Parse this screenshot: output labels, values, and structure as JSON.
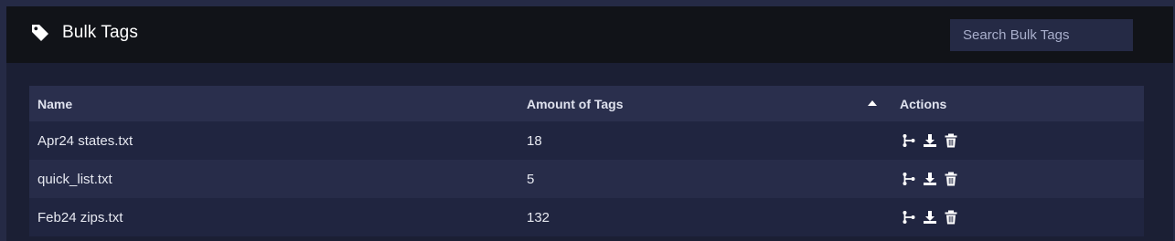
{
  "header": {
    "title": "Bulk Tags",
    "icon": "tag-icon",
    "search_placeholder": "Search Bulk Tags"
  },
  "table": {
    "columns": [
      "Name",
      "Amount of Tags",
      "Actions"
    ],
    "sort": {
      "column": "Amount of Tags",
      "direction": "ascending"
    },
    "rows": [
      {
        "name": "Apr24 states.txt",
        "amount": "18"
      },
      {
        "name": "quick_list.txt",
        "amount": "5"
      },
      {
        "name": "Feb24 zips.txt",
        "amount": "132"
      }
    ],
    "row_actions": [
      "branch-icon",
      "download-icon",
      "trash-icon"
    ]
  },
  "colors": {
    "page_bg": "#252a45",
    "panel_bg": "#1b1f34",
    "header_bg": "#111318",
    "table_header_bg": "#2a2f4d",
    "row_odd": "#202540",
    "row_even": "#272c49"
  }
}
